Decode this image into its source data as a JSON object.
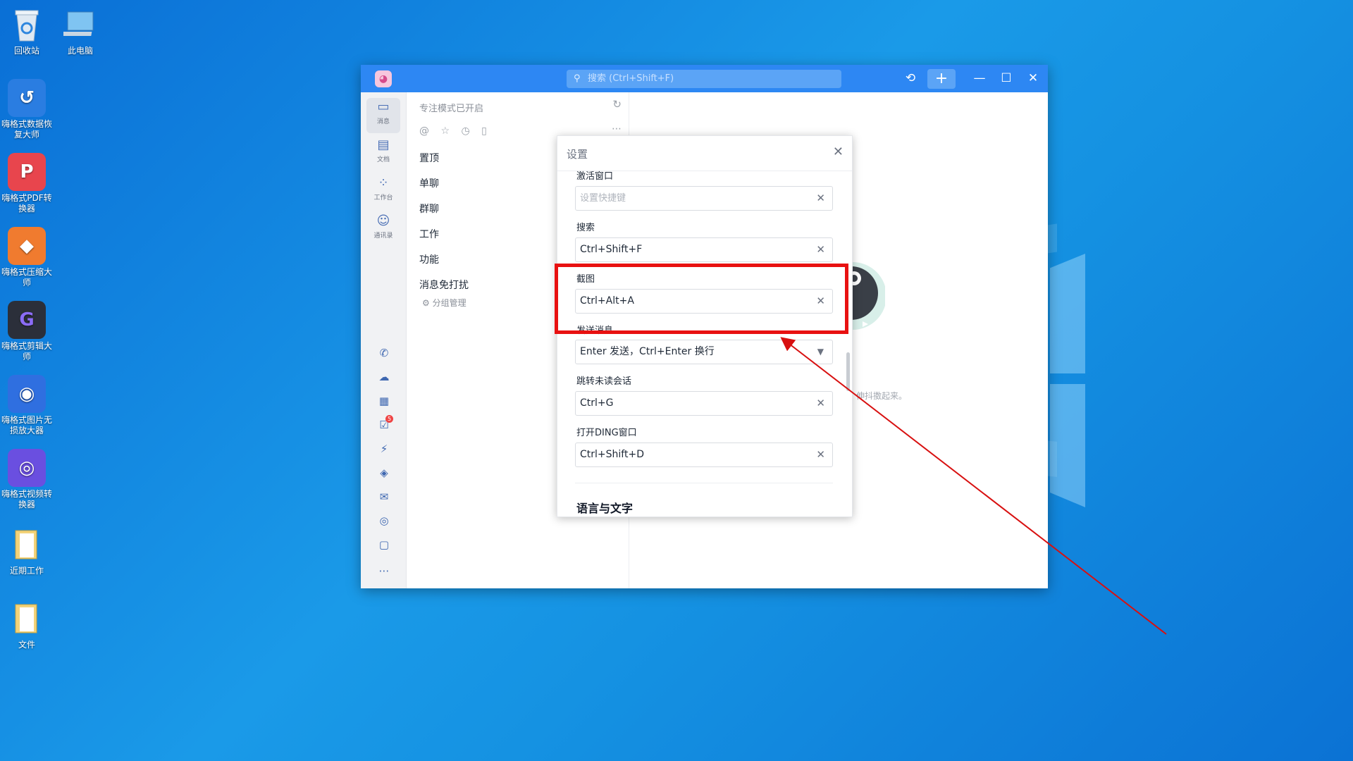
{
  "desktop": {
    "icons": [
      {
        "label": "回收站",
        "icon": "recycle-bin-icon"
      },
      {
        "label": "此电脑",
        "icon": "computer-icon"
      },
      {
        "label": "嗨格式数据恢复大师",
        "icon": "data-recovery-icon"
      },
      {
        "label": "嗨格式PDF转换器",
        "icon": "pdf-converter-icon"
      },
      {
        "label": "嗨格式压缩大师",
        "icon": "compress-icon"
      },
      {
        "label": "嗨格式剪辑大师",
        "icon": "video-editor-icon"
      },
      {
        "label": "嗨格式图片无损放大器",
        "icon": "image-upscaler-icon"
      },
      {
        "label": "嗨格式视频转换器",
        "icon": "video-converter-icon"
      },
      {
        "label": "近期工作",
        "icon": "folder-icon"
      },
      {
        "label": "文件",
        "icon": "folder-icon"
      }
    ]
  },
  "app": {
    "search_placeholder": "搜索 (Ctrl+Shift+F)",
    "nav": [
      {
        "label": "消息",
        "icon": "message-icon"
      },
      {
        "label": "文档",
        "icon": "doc-icon"
      },
      {
        "label": "工作台",
        "icon": "workbench-icon"
      },
      {
        "label": "通讯录",
        "icon": "contacts-icon"
      }
    ],
    "nav_badge": "5",
    "session": {
      "focus_mode": "专注模式已开启",
      "categories": [
        "置顶",
        "单聊",
        "群聊",
        "工作",
        "功能",
        "消息免打扰"
      ],
      "group_manage": "分组管理"
    },
    "hint_text": "伸抖擞起来。"
  },
  "settings_dialog": {
    "title": "设置",
    "fields": [
      {
        "label": "激活窗口",
        "value": "",
        "placeholder": "设置快捷键"
      },
      {
        "label": "搜索",
        "value": "Ctrl+Shift+F"
      },
      {
        "label": "截图",
        "value": "Ctrl+Alt+A"
      },
      {
        "label": "发送消息",
        "value": "Enter 发送，Ctrl+Enter 换行"
      },
      {
        "label": "跳转未读会话",
        "value": "Ctrl+G"
      },
      {
        "label": "打开DING窗口",
        "value": "Ctrl+Shift+D"
      }
    ],
    "section_title": "语言与文字"
  },
  "colors": {
    "titlebar": "#2d87f3",
    "highlight": "#e81111",
    "arrow": "#d81010"
  }
}
